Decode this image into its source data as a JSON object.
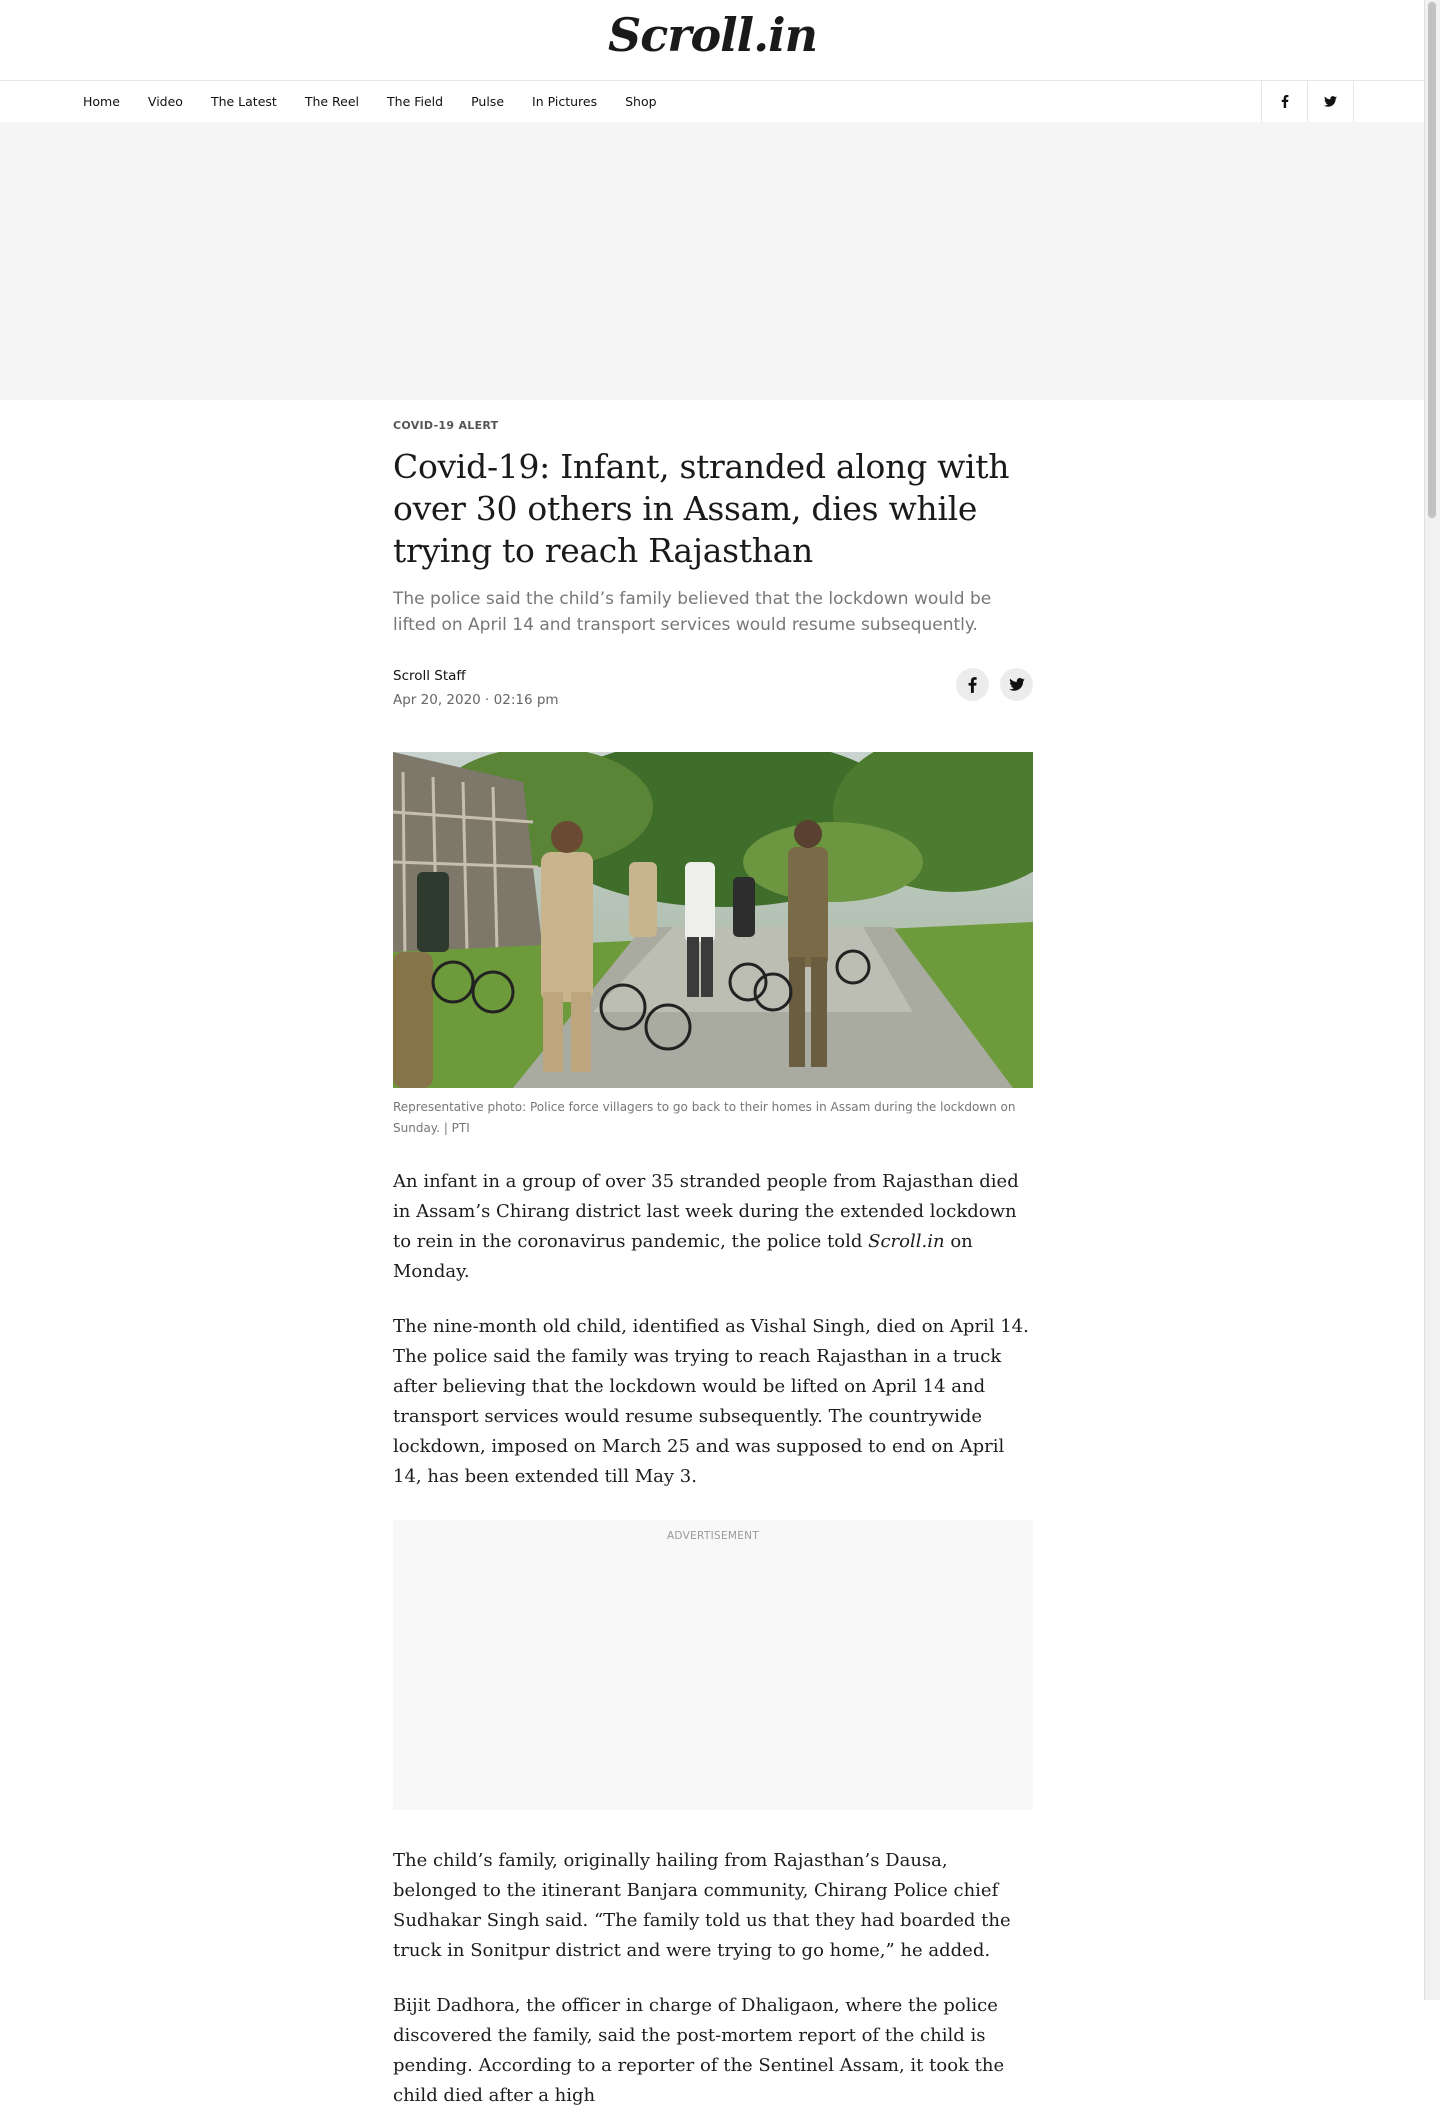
{
  "site": {
    "logo": "Scroll.in"
  },
  "nav": {
    "items": [
      "Home",
      "Video",
      "The Latest",
      "The Reel",
      "The Field",
      "Pulse",
      "In Pictures",
      "Shop"
    ],
    "social": [
      "facebook-icon",
      "twitter-icon"
    ]
  },
  "article": {
    "kicker": "COVID-19 ALERT",
    "headline": "Covid-19: Infant, stranded along with over 30 others in Assam, dies while trying to reach Rajasthan",
    "standfirst": "The police said the child’s family believed that the lockdown would be lifted on April 14 and transport services would resume subsequently.",
    "author": "Scroll Staff",
    "date": "Apr 20, 2020 · 02:16 pm",
    "caption": "Representative photo: Police force villagers to go back to their homes in Assam during the lockdown on Sunday. | PTI",
    "p1_a": "An infant in a group of over 35 stranded people from Rajasthan died in Assam’s Chirang district last week during the extended lockdown to rein in the coronavirus pandemic, the police told ",
    "p1_em": "Scroll.in",
    "p1_b": " on Monday.",
    "p2": "The nine-month old child, identified as Vishal Singh, died on April 14. The police said the family was trying to reach Rajasthan in a truck after believing that the lockdown would be lifted on April 14 and transport services would resume subsequently. The countrywide lockdown, imposed on March 25 and was supposed to end on April 14, has been extended till May 3.",
    "ad_label": "ADVERTISEMENT",
    "p3": "The child’s family, originally hailing from Rajasthan’s Dausa, belonged to the itinerant Banjara community, Chirang Police chief Sudhakar Singh said. “The family told us that they had boarded the truck in Sonitpur district and were trying to go home,” he added.",
    "p4": "Bijit Dadhora, the officer in charge of Dhaligaon, where the police discovered the family, said the post-mortem report of the child is pending. According to a reporter of the Sentinel Assam, it took the child died after a high"
  },
  "colors": {
    "ad_band": "#f5f5f5",
    "share_bg": "#ececec"
  }
}
